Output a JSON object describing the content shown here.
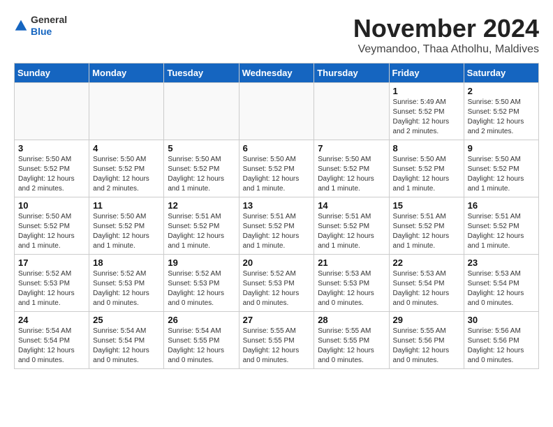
{
  "header": {
    "logo_general": "General",
    "logo_blue": "Blue",
    "month_title": "November 2024",
    "subtitle": "Veymandoo, Thaa Atholhu, Maldives"
  },
  "weekdays": [
    "Sunday",
    "Monday",
    "Tuesday",
    "Wednesday",
    "Thursday",
    "Friday",
    "Saturday"
  ],
  "weeks": [
    [
      {
        "day": "",
        "info": ""
      },
      {
        "day": "",
        "info": ""
      },
      {
        "day": "",
        "info": ""
      },
      {
        "day": "",
        "info": ""
      },
      {
        "day": "",
        "info": ""
      },
      {
        "day": "1",
        "info": "Sunrise: 5:49 AM\nSunset: 5:52 PM\nDaylight: 12 hours and 2 minutes."
      },
      {
        "day": "2",
        "info": "Sunrise: 5:50 AM\nSunset: 5:52 PM\nDaylight: 12 hours and 2 minutes."
      }
    ],
    [
      {
        "day": "3",
        "info": "Sunrise: 5:50 AM\nSunset: 5:52 PM\nDaylight: 12 hours and 2 minutes."
      },
      {
        "day": "4",
        "info": "Sunrise: 5:50 AM\nSunset: 5:52 PM\nDaylight: 12 hours and 2 minutes."
      },
      {
        "day": "5",
        "info": "Sunrise: 5:50 AM\nSunset: 5:52 PM\nDaylight: 12 hours and 1 minute."
      },
      {
        "day": "6",
        "info": "Sunrise: 5:50 AM\nSunset: 5:52 PM\nDaylight: 12 hours and 1 minute."
      },
      {
        "day": "7",
        "info": "Sunrise: 5:50 AM\nSunset: 5:52 PM\nDaylight: 12 hours and 1 minute."
      },
      {
        "day": "8",
        "info": "Sunrise: 5:50 AM\nSunset: 5:52 PM\nDaylight: 12 hours and 1 minute."
      },
      {
        "day": "9",
        "info": "Sunrise: 5:50 AM\nSunset: 5:52 PM\nDaylight: 12 hours and 1 minute."
      }
    ],
    [
      {
        "day": "10",
        "info": "Sunrise: 5:50 AM\nSunset: 5:52 PM\nDaylight: 12 hours and 1 minute."
      },
      {
        "day": "11",
        "info": "Sunrise: 5:50 AM\nSunset: 5:52 PM\nDaylight: 12 hours and 1 minute."
      },
      {
        "day": "12",
        "info": "Sunrise: 5:51 AM\nSunset: 5:52 PM\nDaylight: 12 hours and 1 minute."
      },
      {
        "day": "13",
        "info": "Sunrise: 5:51 AM\nSunset: 5:52 PM\nDaylight: 12 hours and 1 minute."
      },
      {
        "day": "14",
        "info": "Sunrise: 5:51 AM\nSunset: 5:52 PM\nDaylight: 12 hours and 1 minute."
      },
      {
        "day": "15",
        "info": "Sunrise: 5:51 AM\nSunset: 5:52 PM\nDaylight: 12 hours and 1 minute."
      },
      {
        "day": "16",
        "info": "Sunrise: 5:51 AM\nSunset: 5:52 PM\nDaylight: 12 hours and 1 minute."
      }
    ],
    [
      {
        "day": "17",
        "info": "Sunrise: 5:52 AM\nSunset: 5:53 PM\nDaylight: 12 hours and 1 minute."
      },
      {
        "day": "18",
        "info": "Sunrise: 5:52 AM\nSunset: 5:53 PM\nDaylight: 12 hours and 0 minutes."
      },
      {
        "day": "19",
        "info": "Sunrise: 5:52 AM\nSunset: 5:53 PM\nDaylight: 12 hours and 0 minutes."
      },
      {
        "day": "20",
        "info": "Sunrise: 5:52 AM\nSunset: 5:53 PM\nDaylight: 12 hours and 0 minutes."
      },
      {
        "day": "21",
        "info": "Sunrise: 5:53 AM\nSunset: 5:53 PM\nDaylight: 12 hours and 0 minutes."
      },
      {
        "day": "22",
        "info": "Sunrise: 5:53 AM\nSunset: 5:54 PM\nDaylight: 12 hours and 0 minutes."
      },
      {
        "day": "23",
        "info": "Sunrise: 5:53 AM\nSunset: 5:54 PM\nDaylight: 12 hours and 0 minutes."
      }
    ],
    [
      {
        "day": "24",
        "info": "Sunrise: 5:54 AM\nSunset: 5:54 PM\nDaylight: 12 hours and 0 minutes."
      },
      {
        "day": "25",
        "info": "Sunrise: 5:54 AM\nSunset: 5:54 PM\nDaylight: 12 hours and 0 minutes."
      },
      {
        "day": "26",
        "info": "Sunrise: 5:54 AM\nSunset: 5:55 PM\nDaylight: 12 hours and 0 minutes."
      },
      {
        "day": "27",
        "info": "Sunrise: 5:55 AM\nSunset: 5:55 PM\nDaylight: 12 hours and 0 minutes."
      },
      {
        "day": "28",
        "info": "Sunrise: 5:55 AM\nSunset: 5:55 PM\nDaylight: 12 hours and 0 minutes."
      },
      {
        "day": "29",
        "info": "Sunrise: 5:55 AM\nSunset: 5:56 PM\nDaylight: 12 hours and 0 minutes."
      },
      {
        "day": "30",
        "info": "Sunrise: 5:56 AM\nSunset: 5:56 PM\nDaylight: 12 hours and 0 minutes."
      }
    ]
  ]
}
